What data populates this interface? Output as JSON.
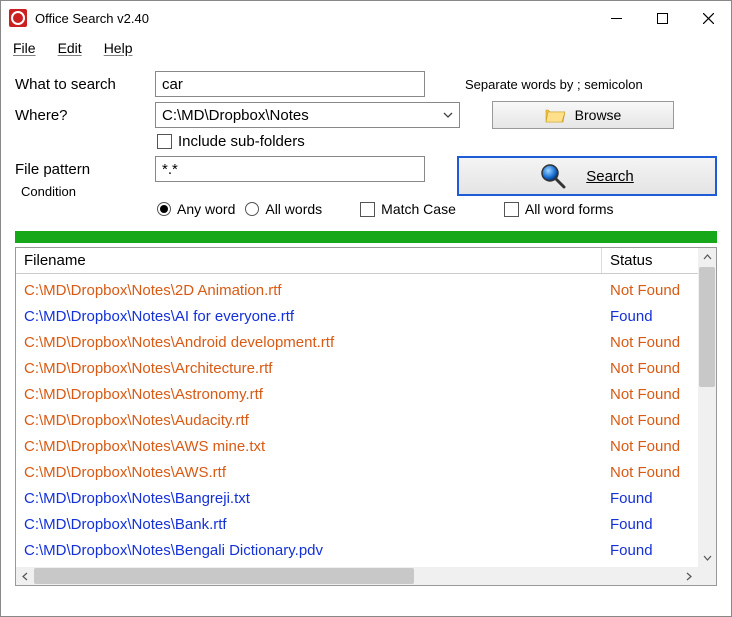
{
  "window": {
    "title": "Office Search v2.40"
  },
  "menu": {
    "file": "File",
    "edit": "Edit",
    "help": "Help"
  },
  "labels": {
    "what": "What to search",
    "where": "Where?",
    "include_sub": "Include sub-folders",
    "pattern": "File pattern",
    "condition": "Condition",
    "hint": "Separate words by ; semicolon",
    "browse": "Browse",
    "search": "Search",
    "any_word": "Any word",
    "all_words": "All words",
    "match_case": "Match Case",
    "all_forms": "All word forms"
  },
  "inputs": {
    "what": "car",
    "where": "C:\\MD\\Dropbox\\Notes",
    "pattern": "*.*"
  },
  "columns": {
    "filename": "Filename",
    "status": "Status"
  },
  "status": {
    "found": "Found",
    "notfound": "Not Found"
  },
  "results": [
    {
      "file": "C:\\MD\\Dropbox\\Notes\\2D Animation.rtf",
      "found": false
    },
    {
      "file": "C:\\MD\\Dropbox\\Notes\\AI for everyone.rtf",
      "found": true
    },
    {
      "file": "C:\\MD\\Dropbox\\Notes\\Android development.rtf",
      "found": false
    },
    {
      "file": "C:\\MD\\Dropbox\\Notes\\Architecture.rtf",
      "found": false
    },
    {
      "file": "C:\\MD\\Dropbox\\Notes\\Astronomy.rtf",
      "found": false
    },
    {
      "file": "C:\\MD\\Dropbox\\Notes\\Audacity.rtf",
      "found": false
    },
    {
      "file": "C:\\MD\\Dropbox\\Notes\\AWS mine.txt",
      "found": false
    },
    {
      "file": "C:\\MD\\Dropbox\\Notes\\AWS.rtf",
      "found": false
    },
    {
      "file": "C:\\MD\\Dropbox\\Notes\\Bangreji.txt",
      "found": true
    },
    {
      "file": "C:\\MD\\Dropbox\\Notes\\Bank.rtf",
      "found": true
    },
    {
      "file": "C:\\MD\\Dropbox\\Notes\\Bengali Dictionary.pdv",
      "found": true
    }
  ]
}
